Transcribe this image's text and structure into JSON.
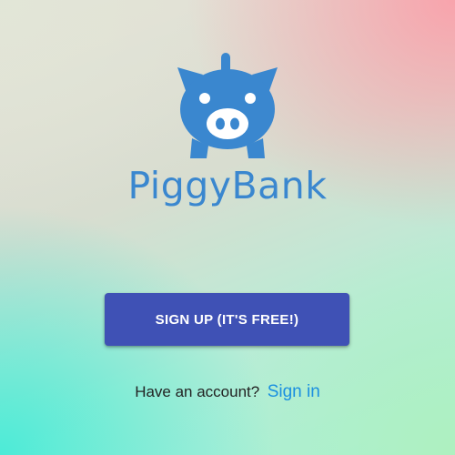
{
  "brand": {
    "name": "PiggyBank",
    "logo_icon": "piggy-bank-icon",
    "color": "#3a87cf"
  },
  "signup_button": {
    "label": "SIGN UP (IT'S FREE!)",
    "color": "#3f51b5"
  },
  "signin": {
    "prompt": "Have an account?",
    "link_label": "Sign in",
    "link_color": "#1a8fe0"
  }
}
